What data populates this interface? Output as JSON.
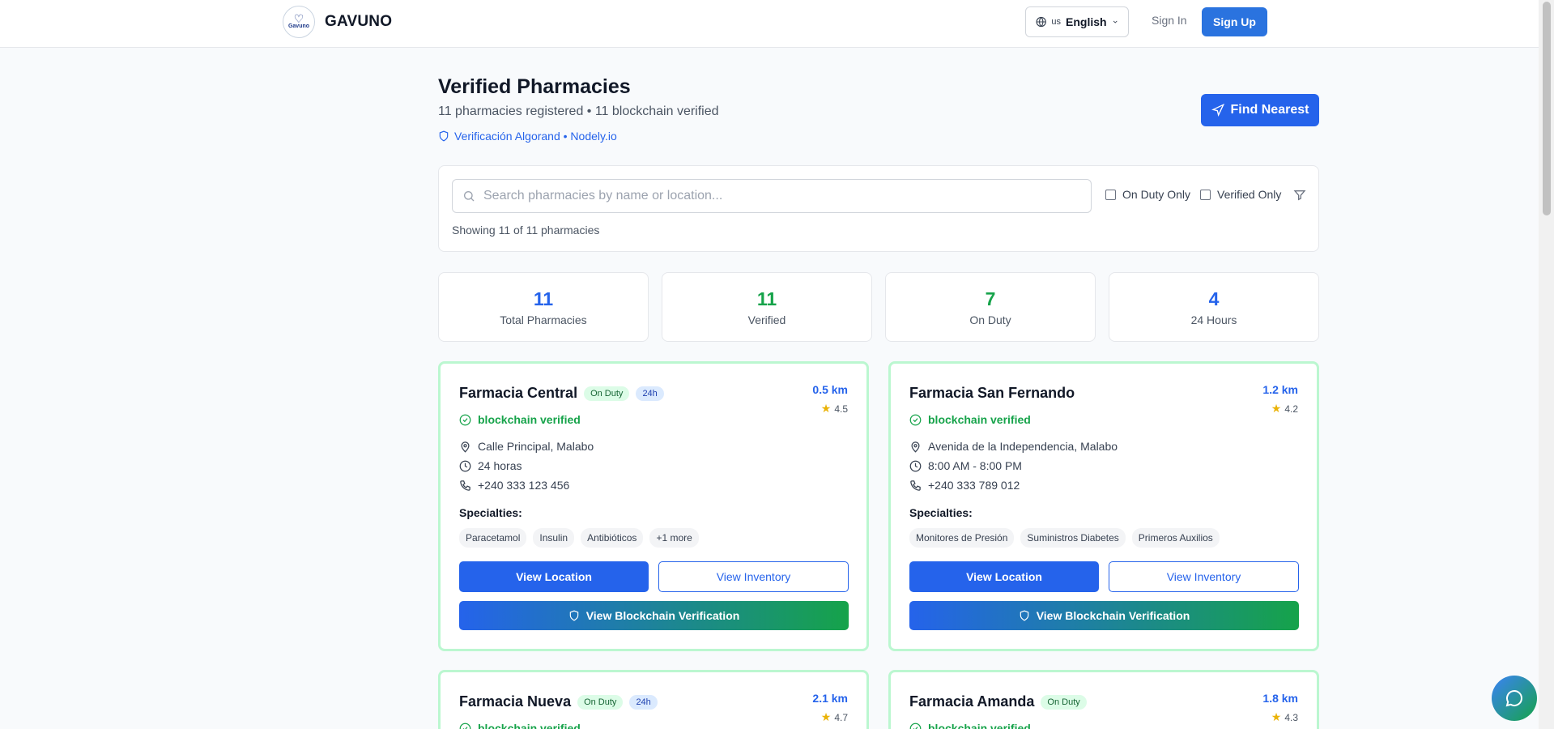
{
  "header": {
    "logo_text": "Gavuno",
    "brand": "GAVUNO",
    "lang_code": "us",
    "lang_name": "English",
    "signin": "Sign In",
    "signup": "Sign Up"
  },
  "page": {
    "title": "Verified Pharmacies",
    "subtitle": "11 pharmacies registered • 11 blockchain verified",
    "verification": "Verificación Algorand • Nodely.io",
    "find_nearest": "Find Nearest"
  },
  "search": {
    "placeholder": "Search pharmacies by name or location...",
    "on_duty_label": "On Duty Only",
    "verified_label": "Verified Only",
    "showing": "Showing 11 of 11 pharmacies"
  },
  "stats": [
    {
      "value": "11",
      "label": "Total Pharmacies",
      "color": "#2563eb"
    },
    {
      "value": "11",
      "label": "Verified",
      "color": "#16a34a"
    },
    {
      "value": "7",
      "label": "On Duty",
      "color": "#16a34a"
    },
    {
      "value": "4",
      "label": "24 Hours",
      "color": "#2563eb"
    }
  ],
  "labels": {
    "blockchain_verified": "blockchain verified",
    "specialties": "Specialties:",
    "view_location": "View Location",
    "view_inventory": "View Inventory",
    "view_blockchain": "View Blockchain Verification",
    "on_duty": "On Duty",
    "h24": "24h"
  },
  "pharmacies": [
    {
      "name": "Farmacia Central",
      "distance": "0.5 km",
      "rating": "4.5",
      "address": "Calle Principal, Malabo",
      "hours": "24 horas",
      "phone": "+240 333 123 456",
      "specialties": [
        "Paracetamol",
        "Insulin",
        "Antibióticos",
        "+1 more"
      ]
    },
    {
      "name": "Farmacia San Fernando",
      "distance": "1.2 km",
      "rating": "4.2",
      "address": "Avenida de la Independencia, Malabo",
      "hours": "8:00 AM - 8:00 PM",
      "phone": "+240 333 789 012",
      "specialties": [
        "Monitores de Presión",
        "Suministros Diabetes",
        "Primeros Auxilios"
      ]
    },
    {
      "name": "Farmacia Nueva",
      "distance": "2.1 km",
      "rating": "4.7"
    },
    {
      "name": "Farmacia Amanda",
      "distance": "1.8 km",
      "rating": "4.3"
    }
  ],
  "colors": {
    "primary": "#2563eb",
    "success": "#16a34a",
    "card_border": "#bbf7d0"
  }
}
